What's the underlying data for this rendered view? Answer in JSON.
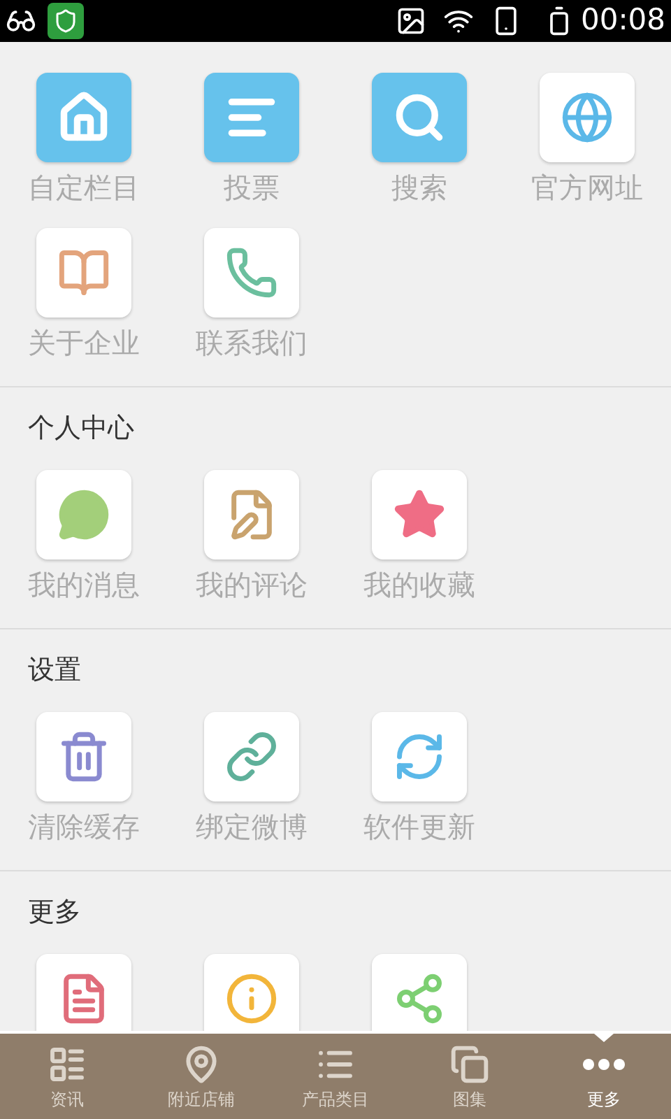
{
  "status_bar": {
    "time": "00:08"
  },
  "sections": [
    {
      "items": [
        {
          "kind": "labeled",
          "label": "自定栏目"
        },
        {
          "kind": "labeled",
          "label": "投票"
        },
        {
          "kind": "labeled",
          "label": "搜索"
        },
        {
          "kind": "labeled",
          "label": "官方网址"
        },
        {
          "kind": "labeled",
          "label": "关于企业"
        },
        {
          "kind": "labeled",
          "label": "联系我们"
        }
      ]
    },
    {
      "title": "个人中心",
      "items": [
        {
          "kind": "labeled",
          "label": "我的消息"
        },
        {
          "kind": "labeled",
          "label": "我的评论"
        },
        {
          "kind": "labeled",
          "label": "我的收藏"
        }
      ]
    },
    {
      "title": "设置",
      "items": [
        {
          "kind": "labeled",
          "label": "清除缓存"
        },
        {
          "kind": "labeled",
          "label": "绑定微博"
        },
        {
          "kind": "labeled",
          "label": "软件更新"
        }
      ]
    },
    {
      "title": "更多",
      "items": [
        {
          "kind": "icon_only"
        },
        {
          "kind": "icon_only"
        },
        {
          "kind": "icon_only"
        }
      ]
    }
  ],
  "tab_bar": [
    {
      "label": "资讯",
      "selected": false
    },
    {
      "label": "附近店铺",
      "selected": false
    },
    {
      "label": "产品类目",
      "selected": false
    },
    {
      "label": "图集",
      "selected": false
    },
    {
      "label": "更多",
      "selected": true
    }
  ]
}
